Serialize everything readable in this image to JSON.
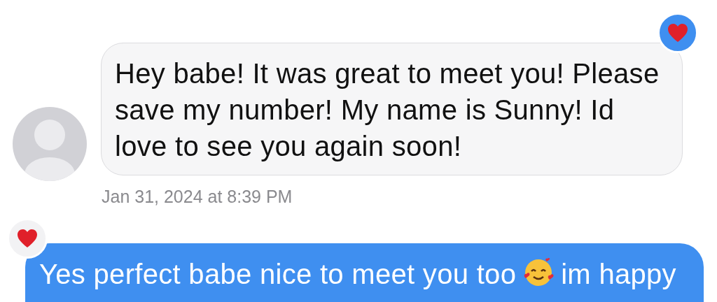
{
  "messages": [
    {
      "kind": "incoming",
      "text": "Hey babe! It was great to meet you! Please save my number! My name is Sunny! Id love to see you again soon!",
      "reaction": {
        "kind": "heart",
        "mine": true
      },
      "timestamp": "Jan 31, 2024 at 8:39 PM"
    },
    {
      "kind": "outgoing",
      "text_before_emoji": "Yes perfect babe nice to meet you too",
      "text_after_emoji": "im happy",
      "reaction": {
        "kind": "heart",
        "mine": false
      }
    }
  ]
}
